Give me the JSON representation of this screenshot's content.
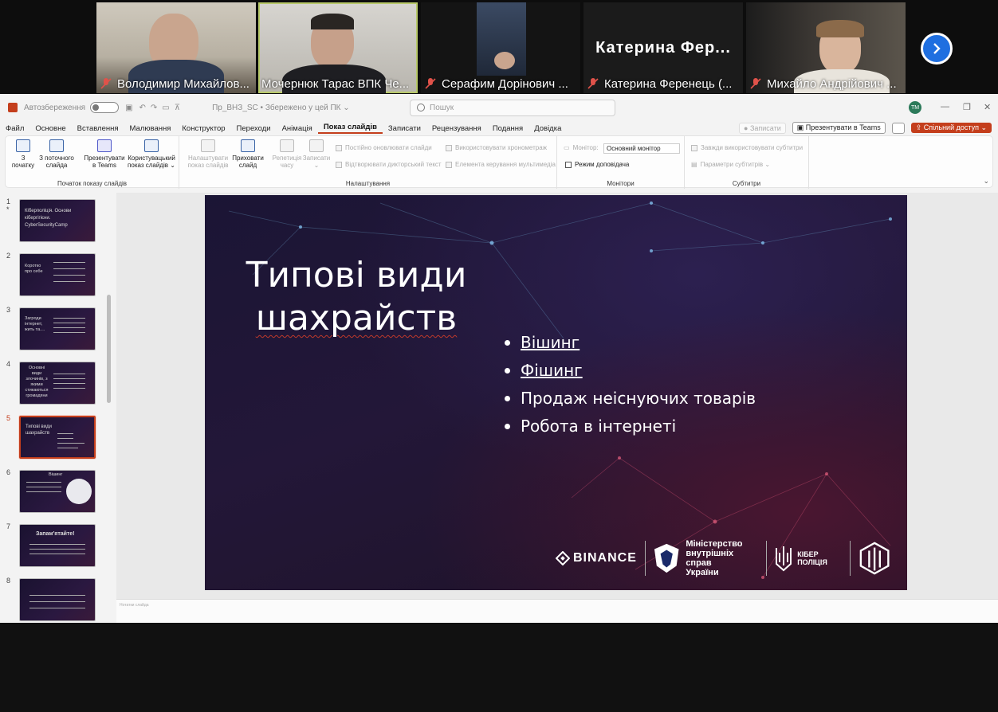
{
  "teams": {
    "participants": [
      {
        "name": "Володимир Михайлов...",
        "muted": true,
        "active": false
      },
      {
        "name": "Мочернюк Тарас ВПК Че...",
        "muted": false,
        "active": true
      },
      {
        "name": "Серафим Дорінович ...",
        "muted": true,
        "active": false
      },
      {
        "name": "Катерина  Ференець (...",
        "muted": true,
        "active": false,
        "initials_banner": "Катерина   Фер..."
      },
      {
        "name": "Михайло Андрійович ...",
        "muted": true,
        "active": false
      }
    ]
  },
  "ppt": {
    "autosave_label": "Автозбереження",
    "file_title": "Пр_ВНЗ_SC • Збережено у цей ПК ⌄",
    "search_placeholder": "Пошук",
    "user_initials": "TM",
    "menu_tabs": [
      "Файл",
      "Основне",
      "Вставлення",
      "Малювання",
      "Конструктор",
      "Переходи",
      "Анімація",
      "Показ слайдів",
      "Записати",
      "Рецензування",
      "Подання",
      "Довідка"
    ],
    "selected_tab": "Показ слайдів",
    "record_btn": "Записати",
    "present_teams_btn": "Презентувати в Teams",
    "share_btn": "Спільний доступ ⌄",
    "ribbon": {
      "start_group": "Початок показу слайдів",
      "btn_from_start": "З\nпочатку",
      "btn_from_current": "З поточного\nслайда",
      "btn_present_teams": "Презентувати\nв Teams",
      "btn_custom": "Користувацький\nпоказ слайдів ⌄",
      "setup_group": "Налаштування",
      "btn_setup": "Налаштувати\nпоказ слайдів",
      "btn_hide": "Приховати\nслайд",
      "btn_rehearse": "Репетиція\nчасу",
      "btn_record": "Записати\n⌄",
      "chk_keep_updated": "Постійно оновлювати слайди",
      "chk_play_narrations": "Відтворювати дикторський текст",
      "chk_use_timings": "Використовувати хронометраж",
      "chk_media_controls": "Елемента керування мультимедіа",
      "monitors_group": "Монітори",
      "monitor_label": "Монітор:",
      "monitor_value": "Основний монітор",
      "presenter_view": "Режим доповідача",
      "captions_group": "Субтитри",
      "chk_always_subtitles": "Завжди використовувати субтитри",
      "subtitle_settings": "Параметри субтитрів ⌄"
    },
    "thumbnails": [
      {
        "num": "1",
        "star": "*",
        "title": "Кіберполіція. Основи кібергігієни. CyberSecurityCamp"
      },
      {
        "num": "2",
        "star": "",
        "title": "Коротко про себе"
      },
      {
        "num": "3",
        "star": "",
        "title": "Загроди інтернет, жить та...."
      },
      {
        "num": "4",
        "star": "",
        "title": "Основні види злочинів, з якими стикаються громадяни"
      },
      {
        "num": "5",
        "star": "",
        "title": "Типові види шахрайств"
      },
      {
        "num": "6",
        "star": "",
        "title": "Вішинг"
      },
      {
        "num": "7",
        "star": "",
        "title": "Запам'ятайте!"
      },
      {
        "num": "8",
        "star": "",
        "title": ""
      }
    ],
    "selected_slide": "5",
    "notes_placeholder": "Нотатки слайда",
    "slide": {
      "title_line1": "Типові види",
      "title_line2": "шахрайств",
      "bullets": [
        "Вішинг",
        "Фішинг",
        "Продаж неіснуючих товарів",
        "Робота в інтернеті"
      ],
      "logo_binance": "BINANCE",
      "logo_ministry": "Міністерство\nвнутрішніх справ\nУкраїни",
      "logo_cyberpolice": "КІБЕР\nПОЛІЦІЯ"
    }
  }
}
